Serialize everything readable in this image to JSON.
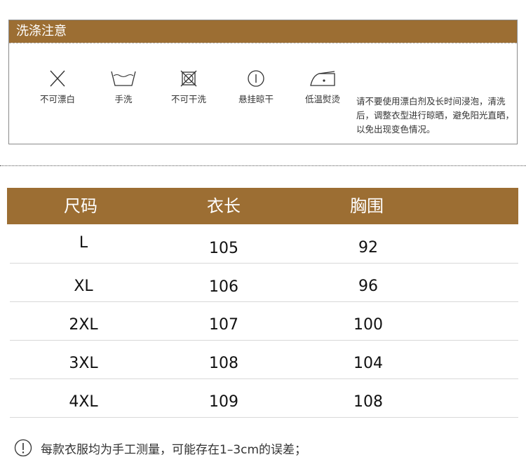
{
  "care": {
    "title": "洗涤注意",
    "items": [
      {
        "icon": "no-bleach-icon",
        "label": "不可漂白"
      },
      {
        "icon": "hand-wash-icon",
        "label": "手洗"
      },
      {
        "icon": "no-dry-clean-icon",
        "label": "不可干洗"
      },
      {
        "icon": "hang-dry-icon",
        "label": "悬挂晾干"
      },
      {
        "icon": "low-iron-icon",
        "label": "低温熨烫"
      }
    ],
    "note": "请不要使用漂白剂及长时间浸泡，清洗后，调整衣型进行晾晒，避免阳光直晒，以免出现变色情况。"
  },
  "size_table": {
    "headers": [
      "尺码",
      "衣长",
      "胸围"
    ],
    "rows": [
      [
        "L",
        "105",
        "92"
      ],
      [
        "XL",
        "106",
        "96"
      ],
      [
        "2XL",
        "107",
        "100"
      ],
      [
        "3XL",
        "108",
        "104"
      ],
      [
        "4XL",
        "109",
        "108"
      ]
    ]
  },
  "footer": {
    "note": "每款衣服均为手工测量，可能存在1–3cm的误差；"
  },
  "colors": {
    "accent": "#9c6e33"
  }
}
